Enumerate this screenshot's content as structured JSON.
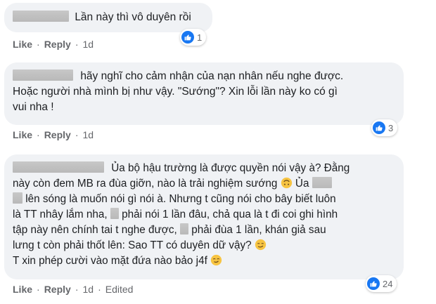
{
  "comments": [
    {
      "text": "Lần này thì vô duyên rồi",
      "actions": {
        "like": "Like",
        "reply": "Reply",
        "time": "1d"
      },
      "reactions": {
        "count": "1"
      }
    },
    {
      "lines": [
        "hãy nghĩ cho cảm nhận của nạn nhân nếu nghe được.",
        "Hoặc người nhà mình bị như vậy. \"Sướng\"? Xin lỗi lần này ko có gì",
        "vui nha !"
      ],
      "actions": {
        "like": "Like",
        "reply": "Reply",
        "time": "1d"
      },
      "reactions": {
        "count": "3"
      }
    },
    {
      "segments": {
        "l1": "Ủa bộ hậu trường là được quyền nói vậy à? Đằng",
        "l2a": "này còn đem MB ra đùa giỡn, nào là trải nghiệm sướng",
        "l2b": "Ủa",
        "l3": "lên sóng là muốn nói gì nói à. Nhưng t cũng nói cho bây biết luôn",
        "l4a": "là TT nhây lắm nha,",
        "l4b": "phải nói 1 lần đâu, chả qua là t đi coi ghi hình",
        "l5a": "tập này nên chính tai t nghe được,",
        "l5b": "phải đùa 1 lần, khán giả sau",
        "l6": "lưng t còn phải thốt lên: Sao TT có duyên dữ vậy?",
        "l7": "T xin phép cười vào mặt đứa nào bảo j4f"
      },
      "actions": {
        "like": "Like",
        "reply": "Reply",
        "time": "1d",
        "edited": "Edited"
      },
      "reactions": {
        "count": "24"
      }
    }
  ],
  "icons": {
    "like": "thumbs-up-icon",
    "emoji1": "upside-down-face-emoji",
    "emoji2": "smirking-face-emoji",
    "emoji3": "smiling-face-emoji"
  },
  "colors": {
    "bubble": "#f0f2f5",
    "like_blue": "#1877f2",
    "meta_text": "#65676b",
    "redaction": "#bdbdbd"
  }
}
